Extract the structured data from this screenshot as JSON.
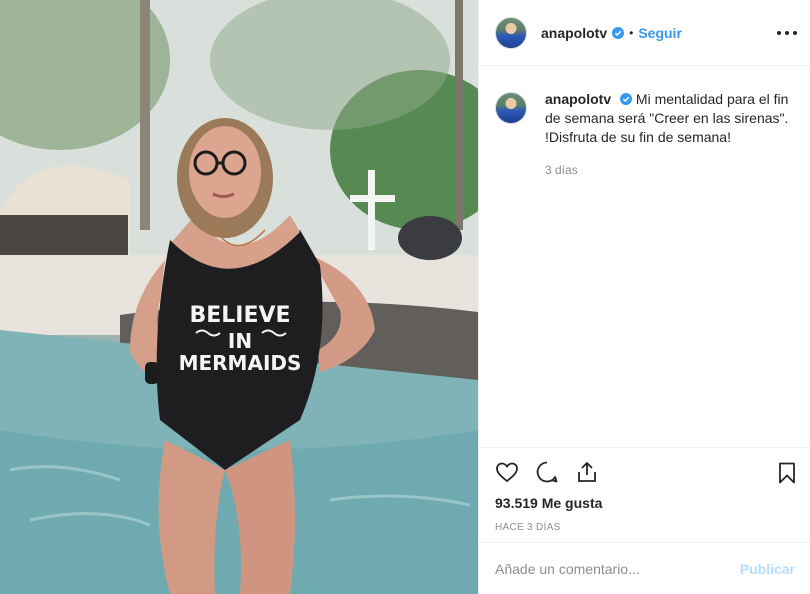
{
  "post": {
    "image_alt": "Mujer en traje de baño negro junto a la piscina",
    "shirt_text": [
      "BELIEVE",
      "IN",
      "MERMAIDS"
    ]
  },
  "header": {
    "username": "anapolotv",
    "separator": "•",
    "follow_label": "Seguir"
  },
  "caption": {
    "username": "anapolotv",
    "text": "Mi mentalidad para el fin de semana será \"Creer en las sirenas\". !Disfruta de su fin de semana!",
    "time": "3 días"
  },
  "footer": {
    "likes": "93.519 Me gusta",
    "posted_ago": "HACE 3 DÍAS",
    "comment_placeholder": "Añade un comentario...",
    "publish_label": "Publicar"
  },
  "colors": {
    "link_blue": "#3897f0",
    "publish_disabled": "#b2dffc",
    "text": "#262626",
    "muted": "#8e8e8e"
  },
  "icons": [
    "verified-badge-icon",
    "more-options-icon",
    "heart-icon",
    "comment-icon",
    "share-icon",
    "bookmark-icon"
  ]
}
